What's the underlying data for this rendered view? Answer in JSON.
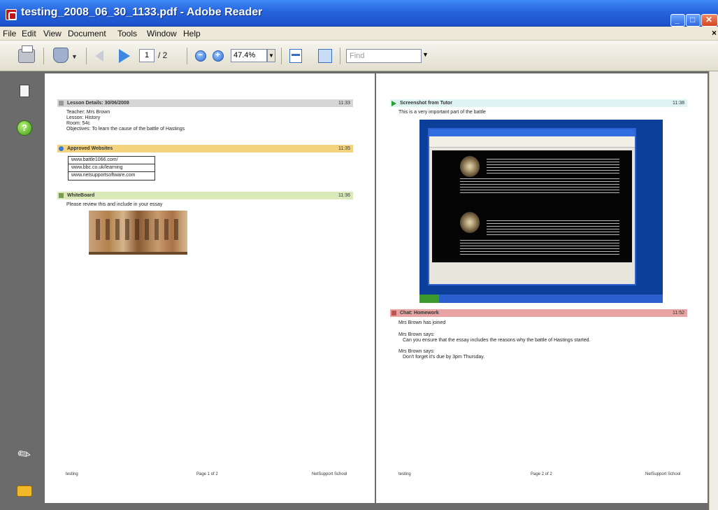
{
  "window": {
    "title": "testing_2008_06_30_1133.pdf - Adobe Reader",
    "menu": [
      "File",
      "Edit",
      "View",
      "Document",
      "Tools",
      "Window",
      "Help"
    ],
    "close_doc_glyph": "×"
  },
  "toolbar": {
    "page_current": "1",
    "page_total": "/ 2",
    "zoom": "47.4%",
    "find_placeholder": "Find",
    "icons": [
      "print-icon",
      "hand-tool-icon",
      "previous-page-icon",
      "next-page-icon",
      "zoom-out-icon",
      "zoom-in-icon",
      "fit-page-icon",
      "full-screen-icon"
    ]
  },
  "left_nav": {
    "icons": [
      "pages-icon",
      "help-icon",
      "attachments-icon",
      "comments-icon"
    ],
    "help_glyph": "?"
  },
  "page1": {
    "lesson": {
      "header": "Lesson Details: 30/06/2008",
      "time": "11:33",
      "lines": [
        "Teacher: Mrs Brown",
        "Lesson: History",
        "Room: 54c",
        "Objectives: To learn the cause of the battle of Hastings"
      ]
    },
    "websites": {
      "header": "Approved Websites",
      "time": "11:35",
      "items": [
        "www.battle1066.com/",
        "www.bbc.co.uk/learning",
        "www.netsupportsoftware.com"
      ]
    },
    "whiteboard": {
      "header": "WhiteBoard",
      "time": "11:36",
      "text": "Please review this and include in your essay"
    },
    "footer": {
      "left": "testing",
      "center": "Page 1 of 2",
      "right": "NetSupport School"
    }
  },
  "page2": {
    "screenshot": {
      "header": "Screenshot from Tutor",
      "time": "11:38",
      "text": "This is a very important part of the battle"
    },
    "chat": {
      "header": "Chat: Homework",
      "time": "11:52",
      "lines": [
        "Mrs Brown has joined",
        "Mrs Brown says:",
        "Can you ensure that the essay includes the reasons why the battle of Hastings started.",
        "Mrs Brown says:",
        "Don't forget it's due by 3pm Thursday."
      ]
    },
    "footer": {
      "left": "testing",
      "center": "Page 2 of 2",
      "right": "NetSupport School"
    }
  },
  "colors": {
    "lesson_bar": "#d6d6d6",
    "websites_bar": "#f3d37c",
    "whiteboard_bar": "#d9e9b9",
    "screenshot_bar": "#dff3f3",
    "chat_bar": "#e8a3a3"
  }
}
